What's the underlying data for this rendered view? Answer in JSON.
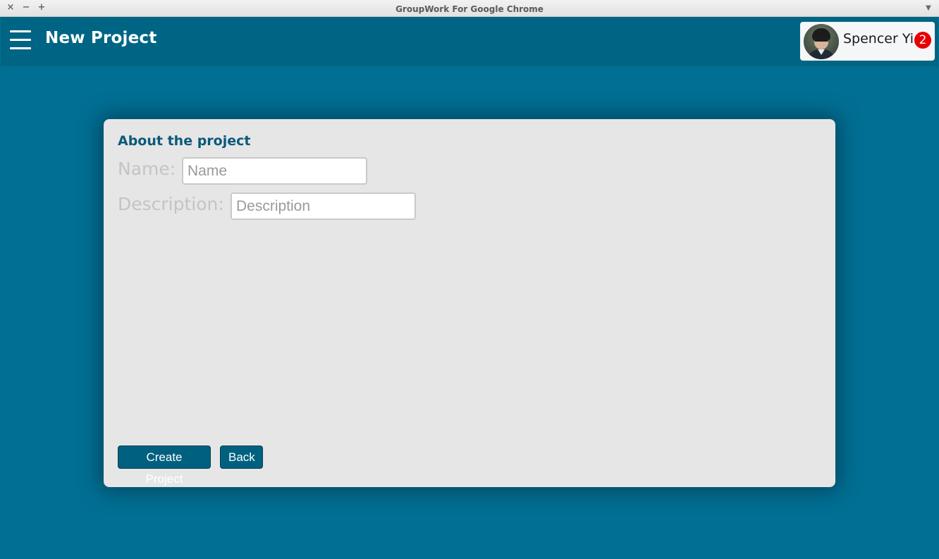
{
  "window": {
    "title": "GroupWork For Google Chrome",
    "controls": {
      "close": "×",
      "minimize": "−",
      "maximize": "+",
      "menu": "▼"
    }
  },
  "header": {
    "title": "New Project",
    "menu_icon": "hamburger-menu-icon",
    "user": {
      "name": "Spencer Yi",
      "notification_count": "2",
      "badge_color": "#e80000"
    }
  },
  "form": {
    "heading": "About the project",
    "name": {
      "label": "Name:",
      "placeholder": "Name",
      "value": ""
    },
    "description": {
      "label": "Description:",
      "placeholder": "Description",
      "value": ""
    },
    "buttons": {
      "create": "Create Project",
      "back": "Back"
    }
  },
  "colors": {
    "background": "#006f93",
    "header": "#006584",
    "card": "#e6e6e6",
    "heading": "#0a5a7a",
    "button": "#00607f"
  }
}
